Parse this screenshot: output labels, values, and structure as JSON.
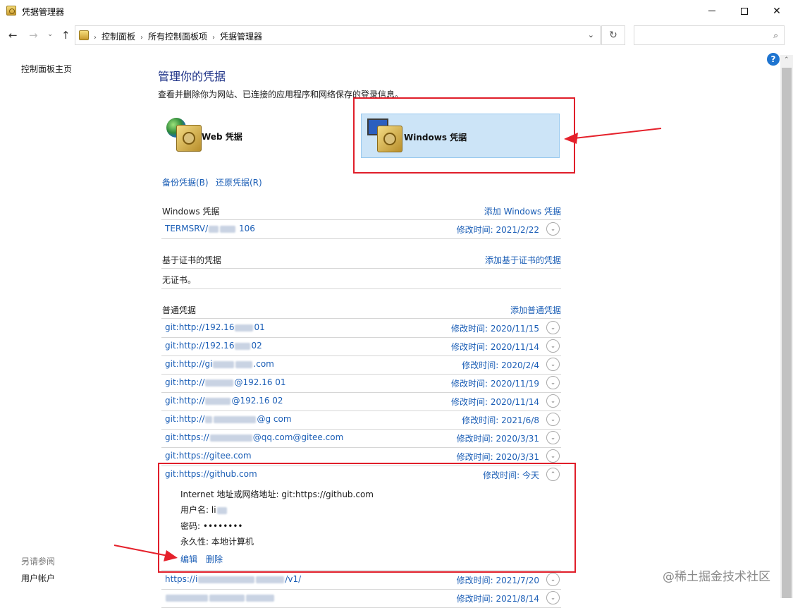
{
  "window": {
    "title": "凭据管理器",
    "minimize_glyph": "",
    "close_glyph": "✕"
  },
  "nav": {
    "back": "←",
    "forward": "→",
    "dropdown": "⌄",
    "up": "↑",
    "breadcrumb": [
      "控制面板",
      "所有控制面板项",
      "凭据管理器"
    ],
    "separator": "›",
    "address_dropdown": "⌄",
    "refresh": "↻",
    "search_placeholder": "",
    "search_glyph": "⌕"
  },
  "help": {
    "glyph": "?"
  },
  "sidebar": {
    "home_link": "控制面板主页",
    "see_also": "另请参阅",
    "user_accounts": "用户帐户"
  },
  "main": {
    "title": "管理你的凭据",
    "description": "查看并删除你为网站、已连接的应用程序和网络保存的登录信息。",
    "web_credentials": "Web 凭据",
    "windows_credentials": "Windows 凭据",
    "backup": "备份凭据(B)",
    "restore": "还原凭据(R)"
  },
  "windows_section": {
    "header": "Windows 凭据",
    "add": "添加 Windows 凭据",
    "items": [
      {
        "name_prefix": "TERMSRV/",
        "name_suffix": "106",
        "date_label": "修改时间:",
        "date": "2021/2/22"
      }
    ]
  },
  "cert_section": {
    "header": "基于证书的凭据",
    "add": "添加基于证书的凭据",
    "empty": "无证书。"
  },
  "generic_section": {
    "header": "普通凭据",
    "add": "添加普通凭据",
    "date_label": "修改时间:",
    "items": [
      {
        "name_prefix": "git:http://192.16",
        "name_suffix": "01",
        "date": "2020/11/15"
      },
      {
        "name_prefix": "git:http://192.16",
        "name_suffix": "02",
        "date": "2020/11/14"
      },
      {
        "name_prefix": "git:http://gi",
        "name_suffix": ".com",
        "date": "2020/2/4"
      },
      {
        "name_prefix": "git:http://",
        "name_suffix": "@192.16  01",
        "date": "2020/11/19"
      },
      {
        "name_prefix": "git:http://",
        "name_suffix": "@192.16  02",
        "date": "2020/11/14"
      },
      {
        "name_prefix": "git:http://",
        "name_suffix": "@g  com",
        "date": "2021/6/8"
      },
      {
        "name_prefix": "git:https://",
        "name_suffix": "@qq.com@gitee.com",
        "date": "2020/3/31"
      },
      {
        "name_prefix": "git:https://gitee.com",
        "name_suffix": "",
        "date": "2020/3/31"
      }
    ],
    "expanded": {
      "name": "git:https://github.com",
      "date": "今天",
      "address_label": "Internet 地址或网络地址:",
      "address_value": "git:https://github.com",
      "username_label": "用户名:",
      "username_value": "li",
      "password_label": "密码:",
      "password_value": "••••••••",
      "persistence_label": "永久性:",
      "persistence_value": "本地计算机",
      "edit": "编辑",
      "delete": "删除"
    },
    "after_items": [
      {
        "name_prefix": "https://i",
        "name_suffix": "/v1/",
        "date": "2021/7/20"
      },
      {
        "name_prefix": "",
        "name_suffix": "",
        "date": "2021/8/14"
      }
    ]
  },
  "watermark": "@稀土掘金技术社区",
  "chevron_down": "⌄",
  "chevron_up": "⌃"
}
